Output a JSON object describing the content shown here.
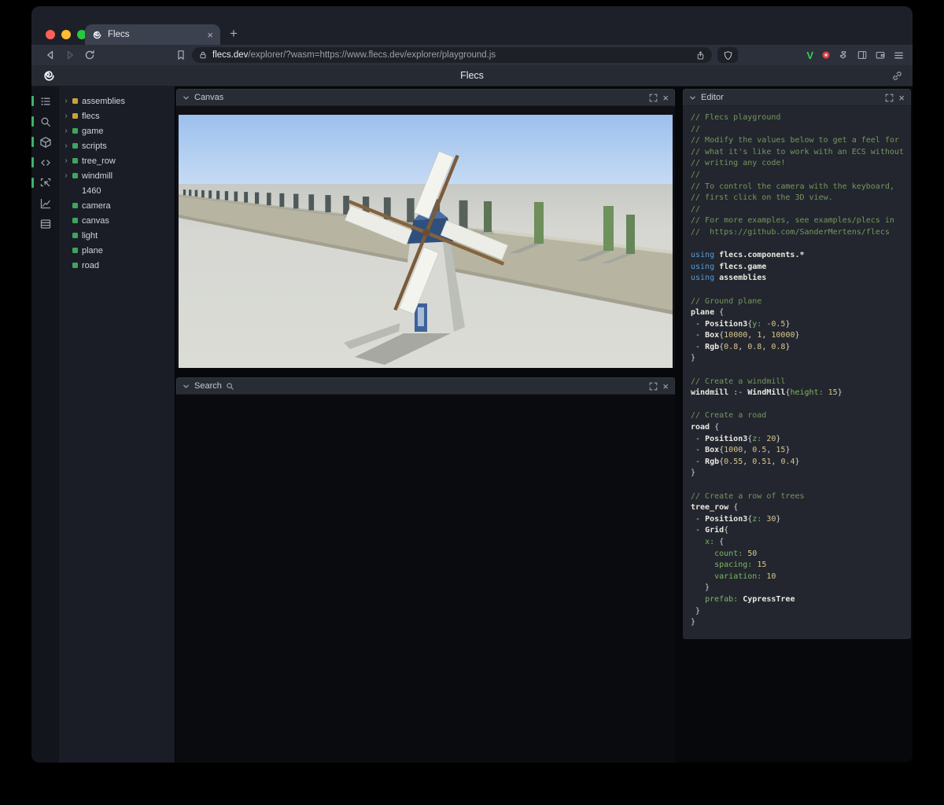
{
  "browser": {
    "tab": {
      "title": "Flecs",
      "close_label": "×",
      "new_tab_label": "+"
    },
    "url": {
      "host": "flecs.dev",
      "rest": "/explorer/?wasm=https://www.flecs.dev/explorer/playground.js"
    }
  },
  "header": {
    "title": "Flecs"
  },
  "colors": {
    "accent": "#3eb46a",
    "module_yellow": "#c7a433",
    "entity_green": "#3fa45f",
    "syntax": {
      "comment": "#74975e",
      "keyword": "#569cd6",
      "ident": "#e9e9e2",
      "number": "#d6c78a",
      "prop": "#7cb662",
      "def": "#d2d4d8"
    }
  },
  "rail": {
    "items": [
      {
        "name": "entities-icon",
        "active": true
      },
      {
        "name": "search-icon",
        "active": true
      },
      {
        "name": "components-icon",
        "active": true
      },
      {
        "name": "scripts-icon",
        "active": true
      },
      {
        "name": "inspect-icon",
        "active": true
      },
      {
        "name": "charts-icon",
        "active": false
      },
      {
        "name": "tables-icon",
        "active": false
      }
    ]
  },
  "tree": {
    "items": [
      {
        "label": "assemblies",
        "color": "#c7a433",
        "expandable": true
      },
      {
        "label": "flecs",
        "color": "#c7a433",
        "expandable": true
      },
      {
        "label": "game",
        "color": "#3fa45f",
        "expandable": true
      },
      {
        "label": "scripts",
        "color": "#3fa45f",
        "expandable": true
      },
      {
        "label": "tree_row",
        "color": "#3fa45f",
        "expandable": true
      },
      {
        "label": "windmill",
        "color": "#3fa45f",
        "expandable": true
      },
      {
        "label": "1460",
        "color": "",
        "expandable": false
      },
      {
        "label": "camera",
        "color": "#3fa45f",
        "expandable": false
      },
      {
        "label": "canvas",
        "color": "#3fa45f",
        "expandable": false
      },
      {
        "label": "light",
        "color": "#3fa45f",
        "expandable": false
      },
      {
        "label": "plane",
        "color": "#3fa45f",
        "expandable": false
      },
      {
        "label": "road",
        "color": "#3fa45f",
        "expandable": false
      }
    ]
  },
  "panels": {
    "canvas": {
      "title": "Canvas"
    },
    "search": {
      "title": "Search"
    },
    "editor": {
      "title": "Editor"
    }
  },
  "code": {
    "lines": [
      [
        {
          "t": "// Flecs playground",
          "c": "c"
        }
      ],
      [
        {
          "t": "//",
          "c": "c"
        }
      ],
      [
        {
          "t": "// Modify the values below to get a feel for",
          "c": "c"
        }
      ],
      [
        {
          "t": "// what it's like to work with an ECS without",
          "c": "c"
        }
      ],
      [
        {
          "t": "// writing any code!",
          "c": "c"
        }
      ],
      [
        {
          "t": "//",
          "c": "c"
        }
      ],
      [
        {
          "t": "// To control the camera with the keyboard,",
          "c": "c"
        }
      ],
      [
        {
          "t": "// first click on the 3D view.",
          "c": "c"
        }
      ],
      [
        {
          "t": "//",
          "c": "c"
        }
      ],
      [
        {
          "t": "// For more examples, see examples/plecs in",
          "c": "c"
        }
      ],
      [
        {
          "t": "//  https://github.com/SanderMertens/flecs",
          "c": "c"
        }
      ],
      [],
      [
        {
          "t": "using ",
          "c": "k"
        },
        {
          "t": "flecs.components.*",
          "c": "b"
        }
      ],
      [
        {
          "t": "using ",
          "c": "k"
        },
        {
          "t": "flecs.game",
          "c": "b"
        }
      ],
      [
        {
          "t": "using ",
          "c": "k"
        },
        {
          "t": "assemblies",
          "c": "b"
        }
      ],
      [],
      [
        {
          "t": "// Ground plane",
          "c": "c"
        }
      ],
      [
        {
          "t": "plane",
          "c": "b"
        },
        {
          "t": " {",
          "c": "d"
        }
      ],
      [
        {
          "t": " - ",
          "c": "d"
        },
        {
          "t": "Position3",
          "c": "b"
        },
        {
          "t": "{",
          "c": "d"
        },
        {
          "t": "y:",
          "c": "p"
        },
        {
          "t": " ",
          "c": "d"
        },
        {
          "t": "-0.5",
          "c": "n"
        },
        {
          "t": "}",
          "c": "d"
        }
      ],
      [
        {
          "t": " - ",
          "c": "d"
        },
        {
          "t": "Box",
          "c": "b"
        },
        {
          "t": "{",
          "c": "d"
        },
        {
          "t": "10000",
          "c": "n"
        },
        {
          "t": ", ",
          "c": "d"
        },
        {
          "t": "1",
          "c": "n"
        },
        {
          "t": ", ",
          "c": "d"
        },
        {
          "t": "10000",
          "c": "n"
        },
        {
          "t": "}",
          "c": "d"
        }
      ],
      [
        {
          "t": " - ",
          "c": "d"
        },
        {
          "t": "Rgb",
          "c": "b"
        },
        {
          "t": "{",
          "c": "d"
        },
        {
          "t": "0.8",
          "c": "n"
        },
        {
          "t": ", ",
          "c": "d"
        },
        {
          "t": "0.8",
          "c": "n"
        },
        {
          "t": ", ",
          "c": "d"
        },
        {
          "t": "0.8",
          "c": "n"
        },
        {
          "t": "}",
          "c": "d"
        }
      ],
      [
        {
          "t": "}",
          "c": "d"
        }
      ],
      [],
      [
        {
          "t": "// Create a windmill",
          "c": "c"
        }
      ],
      [
        {
          "t": "windmill",
          "c": "b"
        },
        {
          "t": " :- ",
          "c": "d"
        },
        {
          "t": "WindMill",
          "c": "b"
        },
        {
          "t": "{",
          "c": "d"
        },
        {
          "t": "height:",
          "c": "p"
        },
        {
          "t": " ",
          "c": "d"
        },
        {
          "t": "15",
          "c": "n"
        },
        {
          "t": "}",
          "c": "d"
        }
      ],
      [],
      [
        {
          "t": "// Create a road",
          "c": "c"
        }
      ],
      [
        {
          "t": "road",
          "c": "b"
        },
        {
          "t": " {",
          "c": "d"
        }
      ],
      [
        {
          "t": " - ",
          "c": "d"
        },
        {
          "t": "Position3",
          "c": "b"
        },
        {
          "t": "{",
          "c": "d"
        },
        {
          "t": "z:",
          "c": "p"
        },
        {
          "t": " ",
          "c": "d"
        },
        {
          "t": "20",
          "c": "n"
        },
        {
          "t": "}",
          "c": "d"
        }
      ],
      [
        {
          "t": " - ",
          "c": "d"
        },
        {
          "t": "Box",
          "c": "b"
        },
        {
          "t": "{",
          "c": "d"
        },
        {
          "t": "1000",
          "c": "n"
        },
        {
          "t": ", ",
          "c": "d"
        },
        {
          "t": "0.5",
          "c": "n"
        },
        {
          "t": ", ",
          "c": "d"
        },
        {
          "t": "15",
          "c": "n"
        },
        {
          "t": "}",
          "c": "d"
        }
      ],
      [
        {
          "t": " - ",
          "c": "d"
        },
        {
          "t": "Rgb",
          "c": "b"
        },
        {
          "t": "{",
          "c": "d"
        },
        {
          "t": "0.55",
          "c": "n"
        },
        {
          "t": ", ",
          "c": "d"
        },
        {
          "t": "0.51",
          "c": "n"
        },
        {
          "t": ", ",
          "c": "d"
        },
        {
          "t": "0.4",
          "c": "n"
        },
        {
          "t": "}",
          "c": "d"
        }
      ],
      [
        {
          "t": "}",
          "c": "d"
        }
      ],
      [],
      [
        {
          "t": "// Create a row of trees",
          "c": "c"
        }
      ],
      [
        {
          "t": "tree_row",
          "c": "b"
        },
        {
          "t": " {",
          "c": "d"
        }
      ],
      [
        {
          "t": " - ",
          "c": "d"
        },
        {
          "t": "Position3",
          "c": "b"
        },
        {
          "t": "{",
          "c": "d"
        },
        {
          "t": "z:",
          "c": "p"
        },
        {
          "t": " ",
          "c": "d"
        },
        {
          "t": "30",
          "c": "n"
        },
        {
          "t": "}",
          "c": "d"
        }
      ],
      [
        {
          "t": " - ",
          "c": "d"
        },
        {
          "t": "Grid",
          "c": "b"
        },
        {
          "t": "{",
          "c": "d"
        }
      ],
      [
        {
          "t": "   ",
          "c": "d"
        },
        {
          "t": "x:",
          "c": "p"
        },
        {
          "t": " {",
          "c": "d"
        }
      ],
      [
        {
          "t": "     ",
          "c": "d"
        },
        {
          "t": "count:",
          "c": "p"
        },
        {
          "t": " ",
          "c": "d"
        },
        {
          "t": "50",
          "c": "n"
        }
      ],
      [
        {
          "t": "     ",
          "c": "d"
        },
        {
          "t": "spacing:",
          "c": "p"
        },
        {
          "t": " ",
          "c": "d"
        },
        {
          "t": "15",
          "c": "n"
        }
      ],
      [
        {
          "t": "     ",
          "c": "d"
        },
        {
          "t": "variation:",
          "c": "p"
        },
        {
          "t": " ",
          "c": "d"
        },
        {
          "t": "10",
          "c": "n"
        }
      ],
      [
        {
          "t": "   }",
          "c": "d"
        }
      ],
      [
        {
          "t": "   ",
          "c": "d"
        },
        {
          "t": "prefab:",
          "c": "p"
        },
        {
          "t": " ",
          "c": "d"
        },
        {
          "t": "CypressTree",
          "c": "b"
        }
      ],
      [
        {
          "t": " }",
          "c": "d"
        }
      ],
      [
        {
          "t": "}",
          "c": "d"
        }
      ]
    ]
  }
}
